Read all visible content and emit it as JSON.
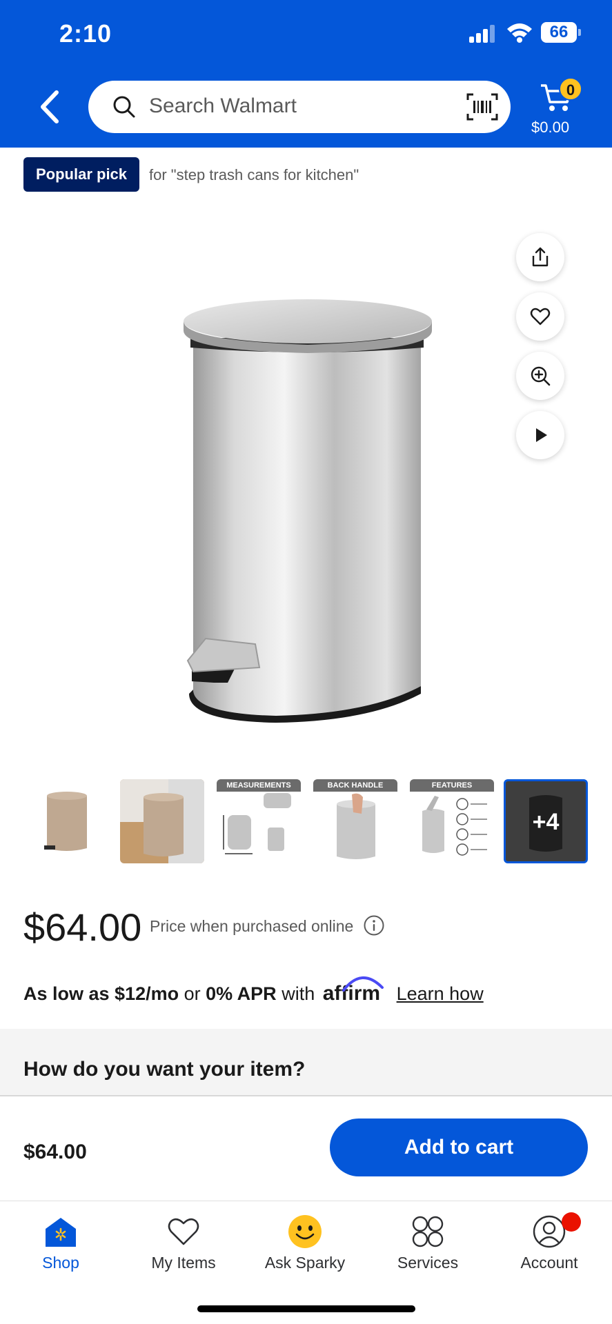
{
  "status_bar": {
    "time": "2:10",
    "battery": "66"
  },
  "header": {
    "search_placeholder": "Search Walmart",
    "cart_count": "0",
    "cart_total": "$0.00",
    "colors": {
      "brand_blue": "#0457d9",
      "spark_yellow": "#ffc220"
    }
  },
  "badge": {
    "label": "Popular pick",
    "query": "for \"step trash cans for kitchen\""
  },
  "side_actions": [
    "share-icon",
    "heart-icon",
    "zoom-in-icon",
    "play-icon"
  ],
  "thumbnails": [
    {
      "label": ""
    },
    {
      "label": ""
    },
    {
      "label": "MEASUREMENTS"
    },
    {
      "label": "BACK HANDLE"
    },
    {
      "label": "FEATURES"
    },
    {
      "label": "+4"
    }
  ],
  "price": {
    "amount": "$64.00",
    "note": "Price when purchased online"
  },
  "financing": {
    "as_low_as": "As low as $12/mo",
    "or": "or",
    "apr": "0% APR",
    "with": "with",
    "brand": "affirm",
    "link": "Learn how"
  },
  "fulfillment": {
    "title": "How do you want your item?"
  },
  "bottom_bar": {
    "price": "$64.00",
    "add_to_cart": "Add to cart"
  },
  "tabs": [
    {
      "label": "Shop",
      "icon": "shop-icon",
      "active": true
    },
    {
      "label": "My Items",
      "icon": "heart-icon"
    },
    {
      "label": "Ask Sparky",
      "icon": "sparky-icon"
    },
    {
      "label": "Services",
      "icon": "services-icon"
    },
    {
      "label": "Account",
      "icon": "account-icon"
    }
  ]
}
